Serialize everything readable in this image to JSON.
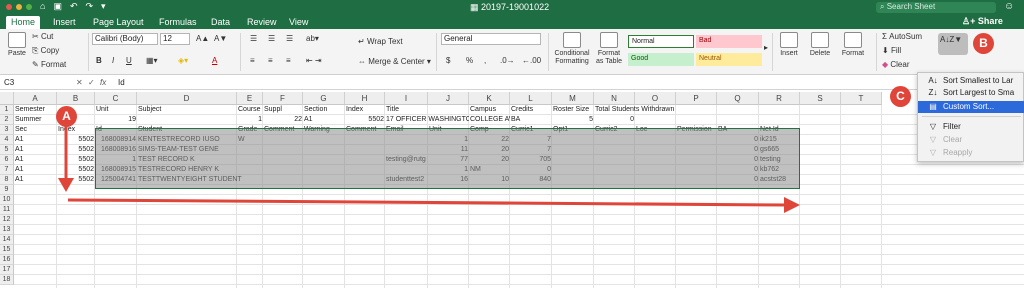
{
  "window": {
    "title": "20197-19001022",
    "search_placeholder": "Search Sheet",
    "share_label": "Share"
  },
  "tabs": [
    "Home",
    "Insert",
    "Page Layout",
    "Formulas",
    "Data",
    "Review",
    "View"
  ],
  "clipboard": {
    "paste": "Paste",
    "cut": "Cut",
    "copy": "Copy",
    "format": "Format"
  },
  "font": {
    "name": "Calibri (Body)",
    "size": "12",
    "grow": "A▲",
    "shrink": "A▼",
    "bold": "B",
    "italic": "I",
    "underline": "U",
    "color": "A"
  },
  "alignment": {
    "wrap": "Wrap Text",
    "merge": "Merge & Center"
  },
  "number": {
    "format": "General",
    "currency": "$",
    "percent": "%",
    "comma": ","
  },
  "styles": {
    "cond_format": "Conditional Formatting",
    "format_table": "Format as Table",
    "normal": "Normal",
    "bad": "Bad",
    "good": "Good",
    "neutral": "Neutral",
    "bad_color": "#ffc7ce",
    "good_color": "#c6efce",
    "neutral_color": "#ffeb9c"
  },
  "cells": {
    "insert": "Insert",
    "delete": "Delete",
    "format": "Format"
  },
  "editing": {
    "autosum": "AutoSum",
    "fill": "Fill",
    "clear": "Clear"
  },
  "formula_bar": {
    "name_box": "C3",
    "fx": "fx",
    "content": "Id"
  },
  "columns": [
    "A",
    "B",
    "C",
    "D",
    "E",
    "F",
    "G",
    "H",
    "I",
    "J",
    "K",
    "L",
    "M",
    "N",
    "O",
    "P",
    "Q",
    "R",
    "S",
    "T"
  ],
  "rows": [
    "1",
    "2",
    "3",
    "4",
    "5",
    "6",
    "7",
    "8",
    "9",
    "10",
    "11",
    "12",
    "13",
    "14",
    "15",
    "16",
    "17",
    "18"
  ],
  "sheet": {
    "r1": {
      "A": "Semester",
      "C": "Unit",
      "D": "Subject",
      "E": "Course",
      "F": "Suppl",
      "G": "Section",
      "H": "Index",
      "I": "Title",
      "K": "Campus",
      "L": "Credits",
      "M": "Roster Size",
      "N": "Total Students Withdrawn"
    },
    "r2": {
      "A": "Summer",
      "C": "19",
      "E": "1",
      "F": "22",
      "G": "A1",
      "H": "5502",
      "I": "17 OFFICER WASHINGTON",
      "K": "COLLEGE AV",
      "L": "BA",
      "M": "5",
      "N": "0"
    },
    "r3": {
      "A": "Sec",
      "B": "Index",
      "C": "Id",
      "D": "Student",
      "E": "Grade",
      "F": "Comment",
      "G": "Warning",
      "H": "Comment",
      "I": "Email",
      "J": "Unit",
      "K": "Comp",
      "L": "Curric1",
      "M": "Opt1",
      "N": "Curric2",
      "O": "Loc",
      "P": "Permission",
      "Q": "BA",
      "R": "Net Id"
    },
    "r4": {
      "A": "A1",
      "B": "5502",
      "C": "168008914",
      "D": "KENTESTRECORD IUSO",
      "E": "W",
      "J": "1",
      "K": "22",
      "L": "7",
      "Q": "0",
      "R": "ik215"
    },
    "r5": {
      "A": "A1",
      "B": "5502",
      "C": "168008916",
      "D": "SIMS-TEAM-TEST GENE",
      "J": "11",
      "K": "20",
      "L": "7",
      "Q": "0",
      "R": "gs665"
    },
    "r6": {
      "A": "A1",
      "B": "5502",
      "C": "1",
      "D": "TEST RECORD K",
      "I": "testing@rutg",
      "J": "77",
      "K": "20",
      "L": "705",
      "Q": "0",
      "R": "testing"
    },
    "r7": {
      "A": "A1",
      "B": "5502",
      "C": "168008915",
      "D": "TESTRECORD HENRY K",
      "J": "1",
      "K": "NM",
      "L": "0",
      "Q": "0",
      "R": "kb762"
    },
    "r8": {
      "A": "A1",
      "B": "5502",
      "C": "125004741",
      "D": "TESTTWENTYEIGHT STUDENT",
      "I": "studenttest2",
      "J": "16",
      "K": "10",
      "L": "840",
      "Q": "0",
      "R": "acstst28"
    }
  },
  "sort_menu": {
    "asc": "Sort Smallest to Lar",
    "desc": "Sort Largest to Sma",
    "custom": "Custom Sort...",
    "filter": "Filter",
    "clear": "Clear",
    "reapply": "Reapply"
  },
  "annotations": {
    "a": "A",
    "b": "B",
    "c": "C",
    "color": "#e0453a"
  }
}
